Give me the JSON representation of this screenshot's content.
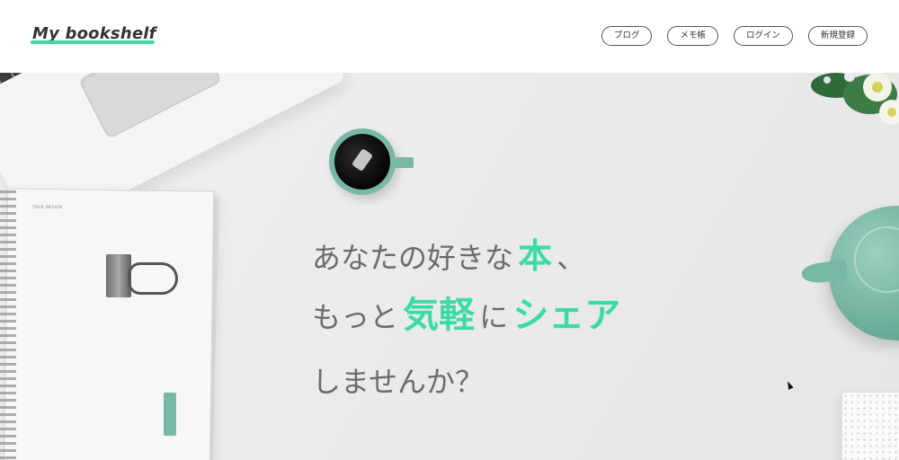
{
  "header": {
    "logo": "My bookshelf",
    "nav": [
      {
        "label": "ブログ"
      },
      {
        "label": "メモ帳"
      },
      {
        "label": "ログイン"
      },
      {
        "label": "新規登録"
      }
    ]
  },
  "hero": {
    "line1": {
      "part1": "あなたの好きな",
      "accent": "本",
      "part2": "、"
    },
    "line2": {
      "part1": "もっと",
      "accent1": "気軽",
      "part2": "に",
      "accent2": "シェア"
    },
    "line3": "しませんか？",
    "notebook_brand": "YOUR DESIGN"
  },
  "colors": {
    "accent": "#3ddba4",
    "text": "#6b6b6b",
    "teal_objects": "#79b8a6"
  }
}
